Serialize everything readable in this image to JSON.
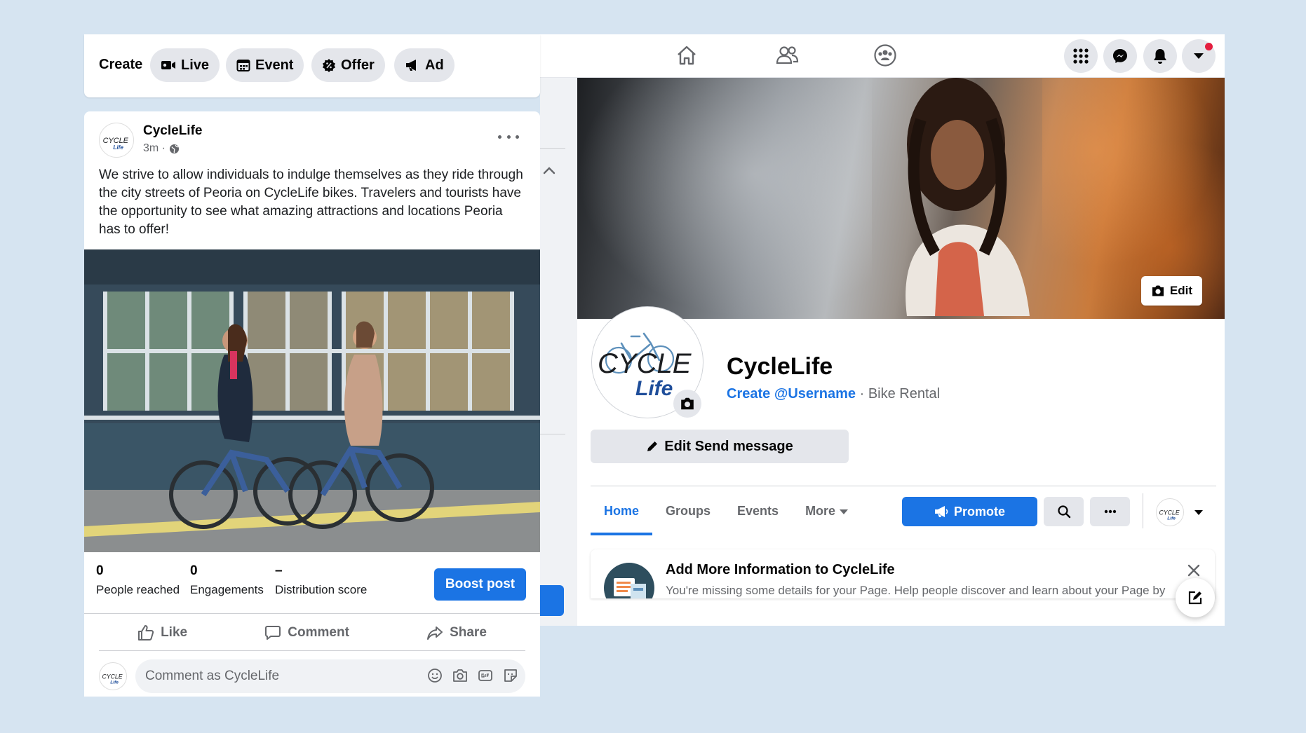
{
  "create_bar": {
    "label": "Create",
    "chips": [
      {
        "label": "Live",
        "icon": "video-icon"
      },
      {
        "label": "Event",
        "icon": "calendar-icon"
      },
      {
        "label": "Offer",
        "icon": "offer-icon"
      },
      {
        "label": "Ad",
        "icon": "megaphone-icon"
      }
    ]
  },
  "post": {
    "author": "CycleLife",
    "time": "3m ·",
    "text": "We strive to allow individuals to indulge themselves as they ride through the city streets of Peoria on CycleLife bikes. Travelers and tourists have the opportunity to see what amazing attractions and locations Peoria has to offer!",
    "stats": [
      {
        "value": "0",
        "label": "People reached"
      },
      {
        "value": "0",
        "label": "Engagements"
      },
      {
        "value": "–",
        "label": "Distribution score"
      }
    ],
    "boost_label": "Boost post",
    "actions": [
      {
        "label": "Like",
        "icon": "thumbs-up-icon"
      },
      {
        "label": "Comment",
        "icon": "comment-bubble-icon"
      },
      {
        "label": "Share",
        "icon": "share-arrow-icon"
      }
    ],
    "comment_placeholder": "Comment as CycleLife"
  },
  "page": {
    "cover_edit_label": "Edit",
    "name": "CycleLife",
    "username_link": "Create @Username",
    "category": " · Bike Rental",
    "edit_send_label": "Edit Send message",
    "tabs": [
      "Home",
      "Groups",
      "Events",
      "More"
    ],
    "active_tab": "Home",
    "promote_label": "Promote",
    "info_card": {
      "title": "Add More Information to CycleLife",
      "text": "You're missing some details for your Page. Help people discover and learn about your Page by adding more information."
    }
  },
  "logo": {
    "top": "CYCLE",
    "bottom": "Life"
  },
  "colors": {
    "accent": "#1b74e4",
    "background": "#d6e4f1",
    "notification": "#e41e3f"
  }
}
